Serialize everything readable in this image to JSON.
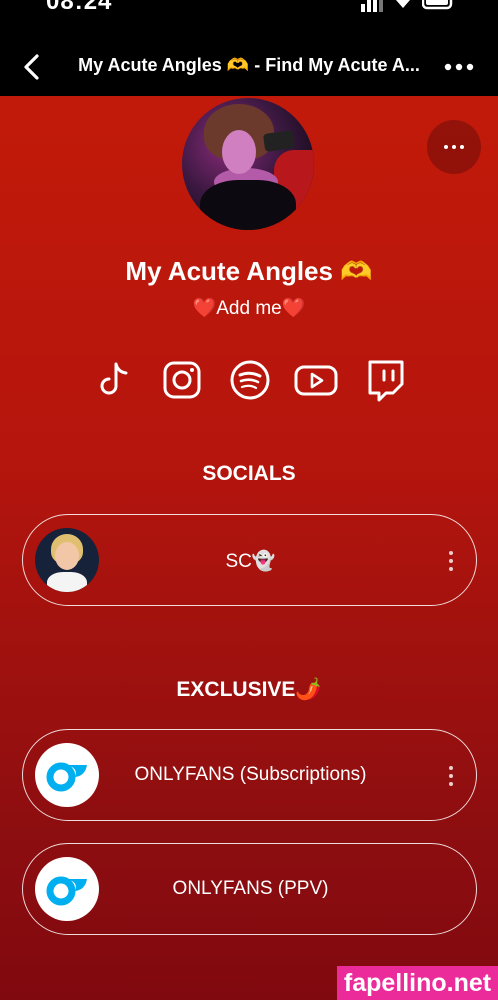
{
  "status_bar": {
    "time": "08:24"
  },
  "nav": {
    "title": "My Acute Angles 🫶 - Find My Acute A..."
  },
  "profile": {
    "name": "My Acute Angles 🫶",
    "bio": "❤️Add me❤️"
  },
  "social_icons": [
    "tiktok-icon",
    "instagram-icon",
    "spotify-icon",
    "youtube-icon",
    "twitch-icon"
  ],
  "sections": [
    {
      "title": "SOCIALS",
      "links": [
        {
          "label": "SC👻",
          "thumb": "bitmoji-avatar",
          "has_menu": true
        }
      ]
    },
    {
      "title": "EXCLUSIVE🌶️",
      "links": [
        {
          "label": "ONLYFANS (Subscriptions)",
          "thumb": "onlyfans-logo",
          "has_menu": true
        },
        {
          "label": "ONLYFANS (PPV)",
          "thumb": "onlyfans-logo",
          "has_menu": false
        }
      ]
    }
  ],
  "watermark": "fapellino.net",
  "colors": {
    "background_top": "#c21a0a",
    "background_bottom": "#80090f",
    "onlyfans_blue": "#00aff0",
    "watermark_pink": "#ec2b9a"
  }
}
